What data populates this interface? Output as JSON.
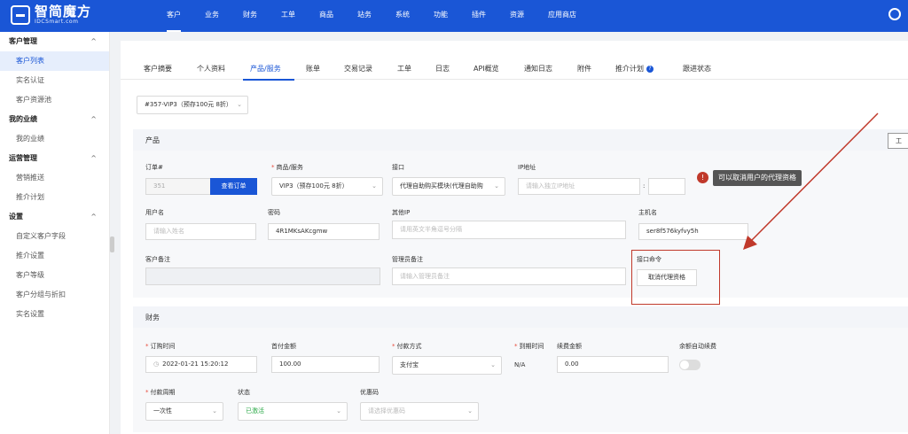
{
  "logo": {
    "title": "智简魔方",
    "subtitle": "IDCSmart.com"
  },
  "nav": [
    "客户",
    "业务",
    "财务",
    "工单",
    "商品",
    "站务",
    "系统",
    "功能",
    "插件",
    "资源",
    "应用商店"
  ],
  "sidebar": {
    "groups": [
      {
        "title": "客户管理",
        "items": [
          "客户列表",
          "实名认证",
          "客户资源池"
        ]
      },
      {
        "title": "我的业绩",
        "items": [
          "我的业绩"
        ]
      },
      {
        "title": "运营管理",
        "items": [
          "营销推送",
          "推介计划"
        ]
      },
      {
        "title": "设置",
        "items": [
          "自定义客户字段",
          "推介设置",
          "客户等级",
          "客户分组与折扣",
          "实名设置"
        ]
      }
    ]
  },
  "tabs": [
    "客户摘要",
    "个人资料",
    "产品/服务",
    "账单",
    "交易记录",
    "工单",
    "日志",
    "API概览",
    "通知日志",
    "附件",
    "推介计划",
    "跟进状态"
  ],
  "product_select": "#357-VIP3（预存100元 8折）",
  "tool_button": "工",
  "product": {
    "section_title": "产品",
    "order_label": "订单#",
    "order_value": "351",
    "view_order_button": "查看订单",
    "service_label": "商品/服务",
    "service_value": "VIP3（预存100元 8折）",
    "api_label": "接口",
    "api_value": "代理自助购买模块(代理自助购",
    "ip_label": "IP地址",
    "ip_placeholder": "请输入独立IP地址",
    "ip_port_sep": ":",
    "username_label": "用户名",
    "username_placeholder": "请输入姓名",
    "password_label": "密码",
    "password_value": "4R1MKsAKcgmw",
    "other_ip_label": "其他IP",
    "other_ip_placeholder": "请用英文半角逗号分隔",
    "hostname_label": "主机名",
    "hostname_value": "ser8f576kyfvy5h",
    "customer_note_label": "客户备注",
    "admin_note_label": "管理员备注",
    "admin_note_placeholder": "请输入管理员备注",
    "api_cmd_label": "接口命令",
    "cancel_agent_button": "取消代理资格"
  },
  "annotation": {
    "badge": "!",
    "text": "可以取消用户的代理资格",
    "color": "#c0392b"
  },
  "finance": {
    "section_title": "财务",
    "order_time_label": "订购时间",
    "order_time_value": "2022-01-21 15:20:12",
    "first_pay_label": "首付金额",
    "first_pay_value": "100.00",
    "pay_method_label": "付款方式",
    "pay_method_value": "支付宝",
    "due_label": "到期时间",
    "due_value": "N/A",
    "renew_amount_label": "续费金额",
    "renew_amount_value": "0.00",
    "auto_renew_label": "余额自动续费",
    "cycle_label": "付款周期",
    "cycle_value": "一次性",
    "status_label": "状态",
    "status_value": "已激活",
    "coupon_label": "优惠码",
    "coupon_placeholder": "请选择优惠码"
  }
}
